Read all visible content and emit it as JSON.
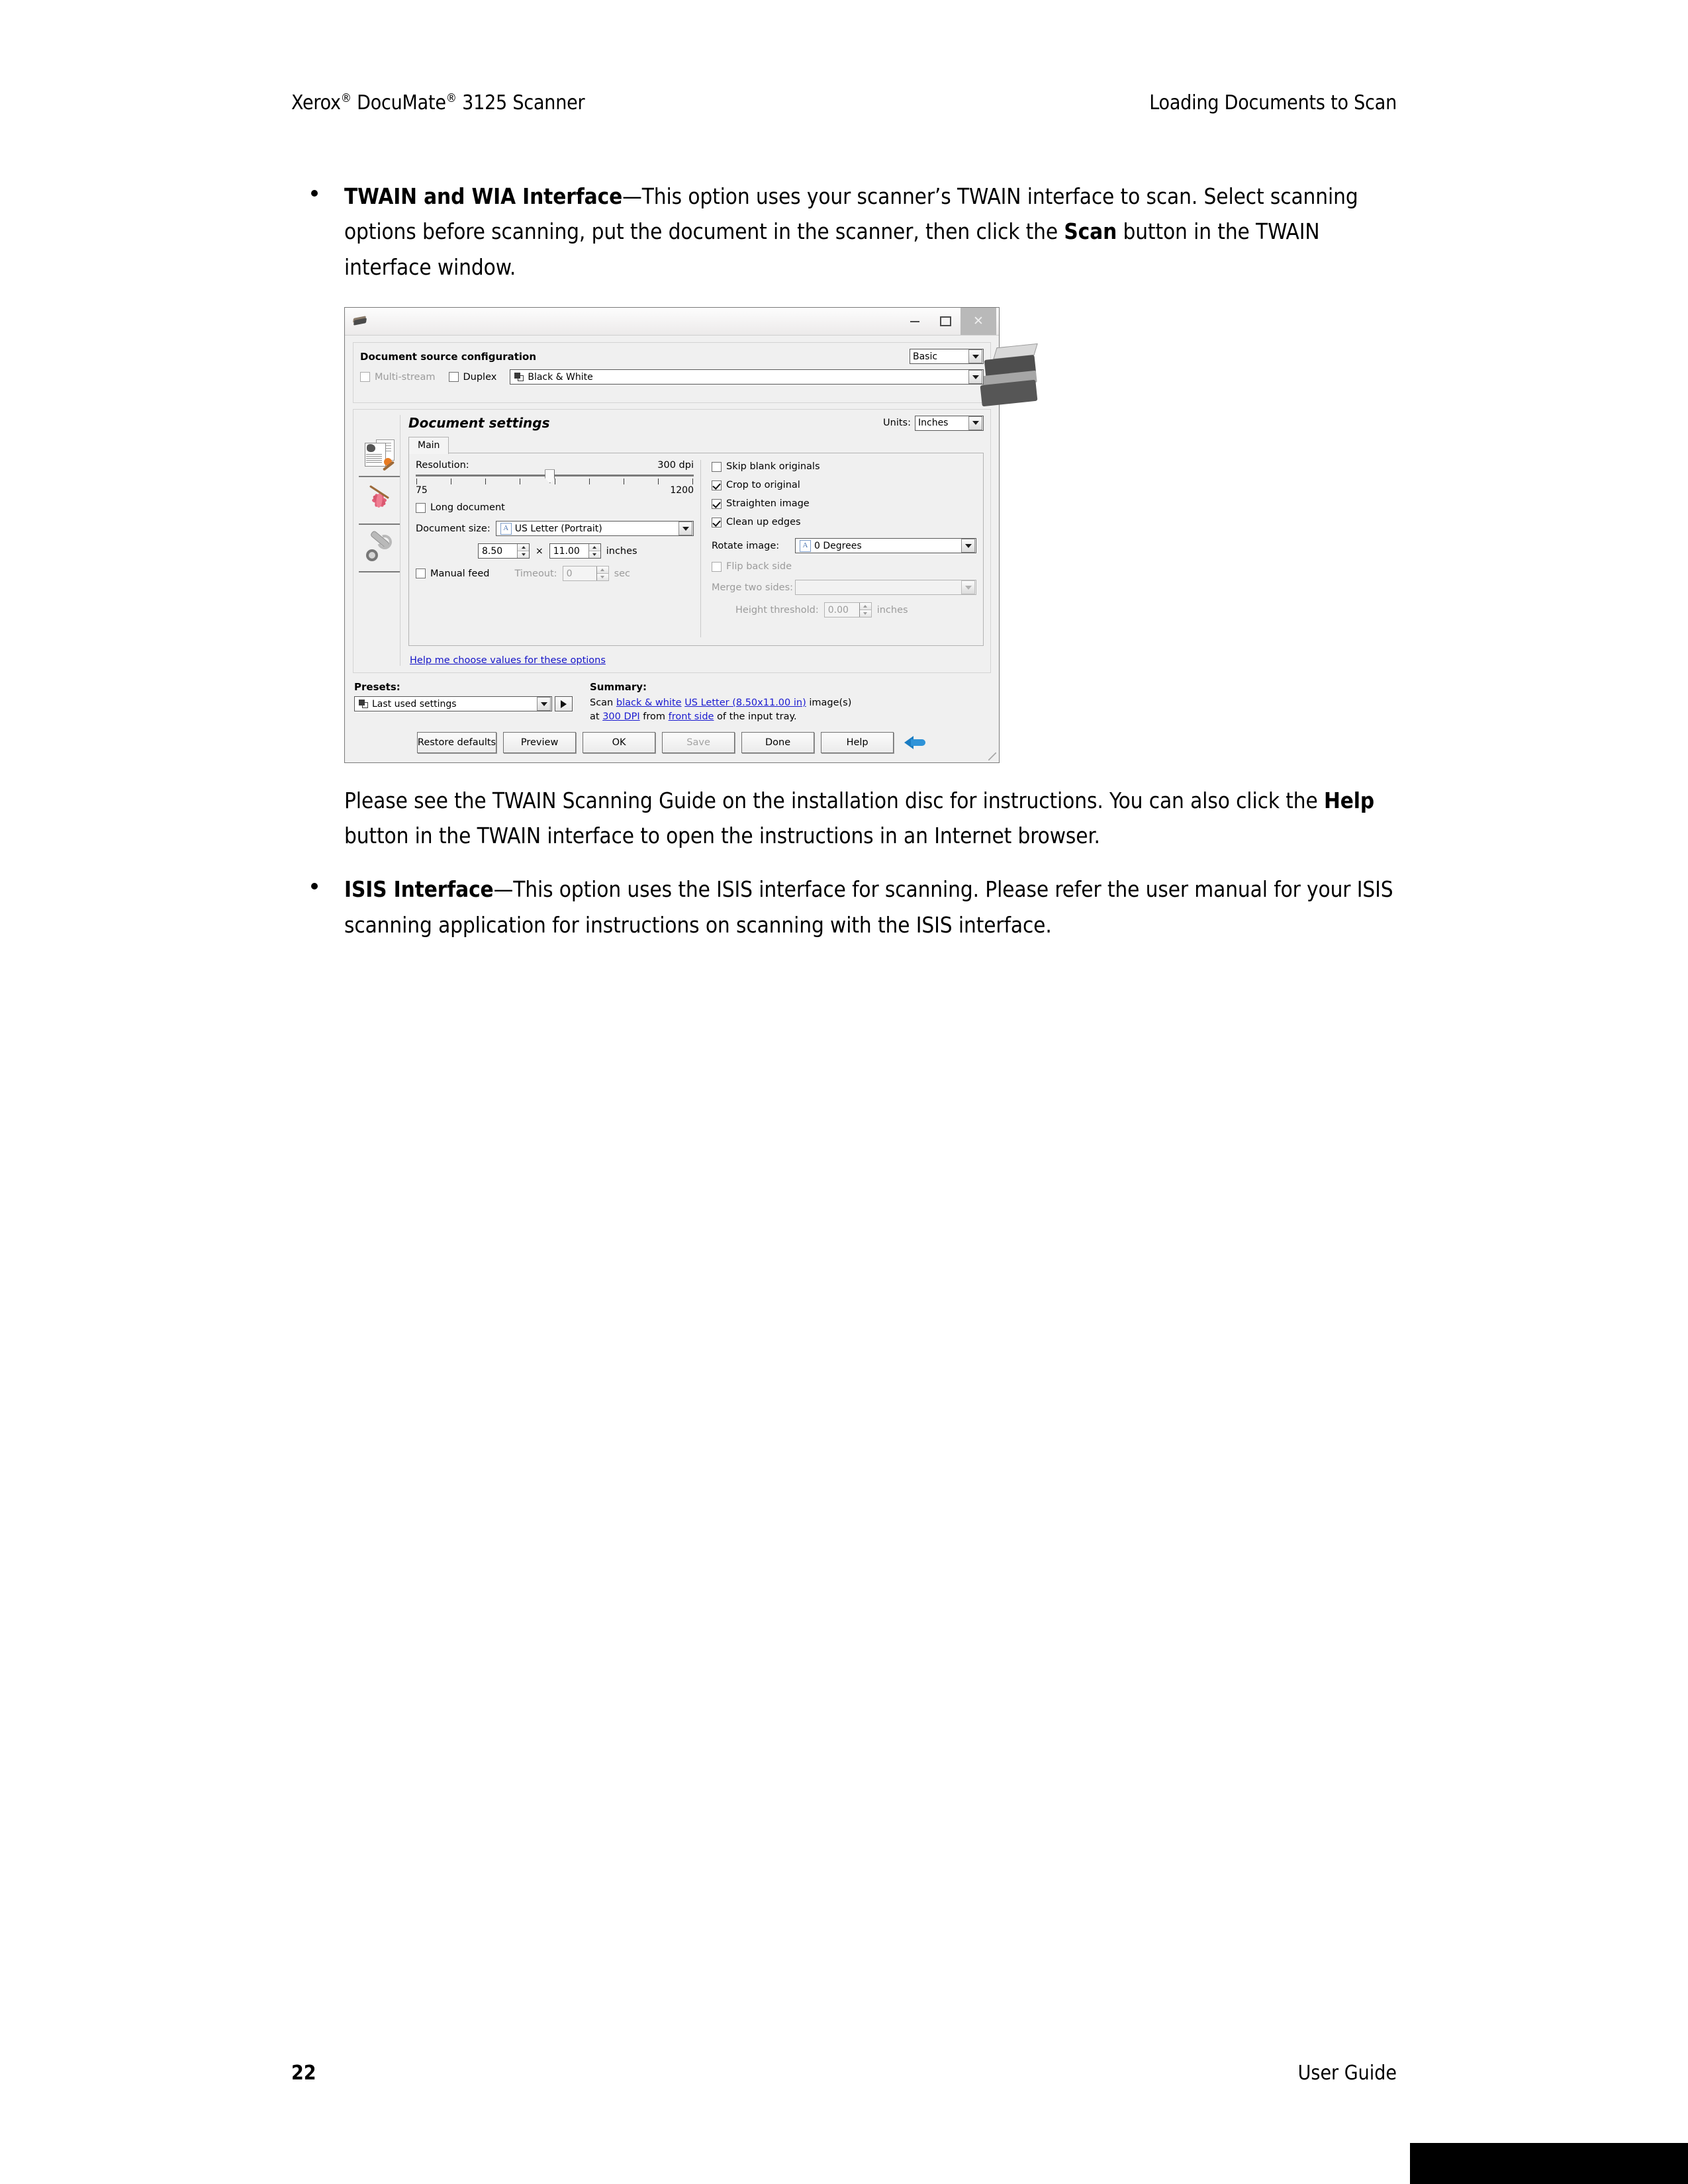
{
  "header": {
    "left_pre": "Xerox",
    "left_sup1": "®",
    "left_mid": " DocuMate",
    "left_sup2": "®",
    "left_post": " 3125 Scanner",
    "right": "Loading Documents to Scan"
  },
  "footer": {
    "page_number": "22",
    "guide_label": "User Guide"
  },
  "body": {
    "bullet1_bold": "TWAIN and WIA Interface",
    "bullet1_text": "—This option uses your scanner’s TWAIN interface to scan. Select scanning options before scanning, put the document in the scanner, then click the ",
    "bullet1_bold2": "Scan",
    "bullet1_text2": " button in the TWAIN interface window.",
    "para1_a": "Please see the TWAIN Scanning Guide on the installation disc for instructions.  You can also click the ",
    "para1_bold": "Help",
    "para1_b": " button in the TWAIN interface to open the instructions in an Internet browser.",
    "bullet2_bold": "ISIS Interface",
    "bullet2_text": "—This option uses the ISIS interface for scanning. Please refer the user manual for your ISIS scanning application for instructions on scanning with the ISIS interface."
  },
  "twain_dialog": {
    "titlebar": {
      "minimize": "–",
      "maximize": "□",
      "close": "✕"
    },
    "source_config": {
      "title": "Document source configuration",
      "mode_preset": "Basic",
      "multi_stream_label": "Multi-stream",
      "duplex_label": "Duplex",
      "color_mode": "Black & White"
    },
    "document_settings": {
      "title": "Document settings",
      "units_label": "Units:",
      "units_value": "Inches",
      "tab_main": "Main",
      "resolution_label": "Resolution:",
      "resolution_value": "300 dpi",
      "resolution_min": "75",
      "resolution_max": "1200",
      "long_document_label": "Long document",
      "document_size_label": "Document size:",
      "document_size_value": "US Letter (Portrait)",
      "width_value": "8.50",
      "times": "×",
      "height_value": "11.00",
      "size_units": "inches",
      "manual_feed_label": "Manual feed",
      "timeout_label": "Timeout:",
      "timeout_value": "0",
      "timeout_units": "sec",
      "skip_blank_label": "Skip blank originals",
      "crop_to_original_label": "Crop to original",
      "straighten_image_label": "Straighten image",
      "clean_up_edges_label": "Clean up edges",
      "rotate_image_label": "Rotate image:",
      "rotate_image_value": "0 Degrees",
      "flip_back_side_label": "Flip back side",
      "merge_two_sides_label": "Merge two sides:",
      "merge_two_sides_value": "",
      "height_threshold_label": "Height threshold:",
      "height_threshold_value": "0.00",
      "height_threshold_units": "inches",
      "help_link": "Help me choose values for these options"
    },
    "presets": {
      "label": "Presets:",
      "value": "Last used settings"
    },
    "summary": {
      "label": "Summary:",
      "line1_a": "Scan ",
      "line1_link1": "black & white",
      "line1_b": " ",
      "line1_link2": "US Letter (8.50x11.00 in)",
      "line1_c": " image(s)",
      "line2_a": "at ",
      "line2_link1": "300 DPI",
      "line2_b": " from ",
      "line2_link2": "front side",
      "line2_c": " of the input tray."
    },
    "buttons": {
      "restore_defaults": "Restore defaults",
      "preview": "Preview",
      "ok": "OK",
      "save": "Save",
      "done": "Done",
      "help": "Help"
    }
  },
  "colors": {
    "link": "#1414c8",
    "dialog_bg": "#f0f0f0",
    "accent_arrow": "#2f93d8"
  }
}
